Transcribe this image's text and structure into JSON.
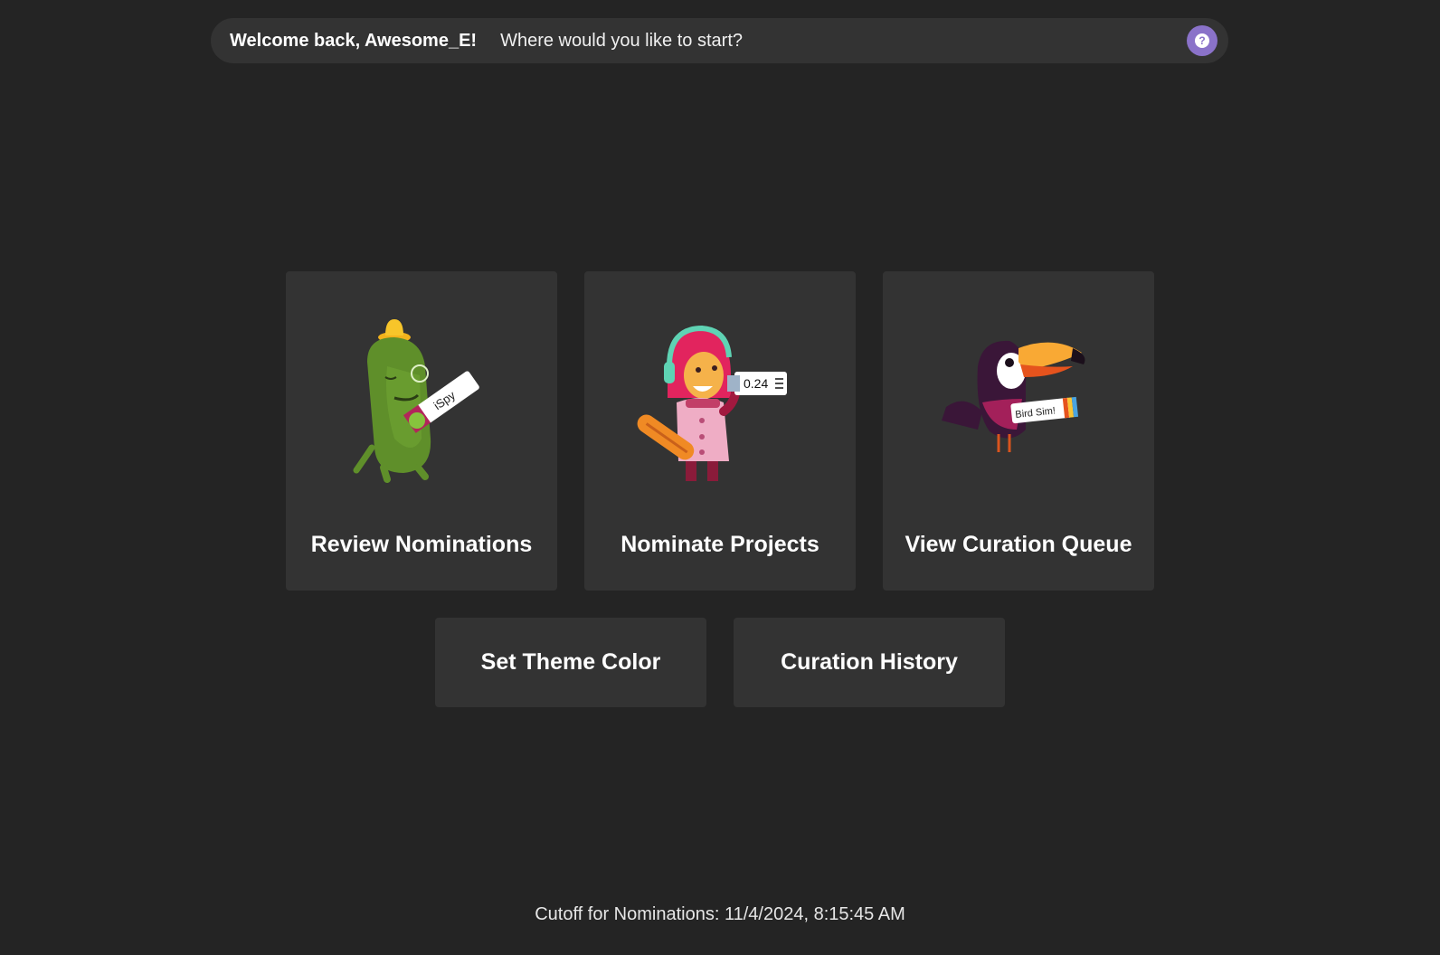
{
  "header": {
    "welcome": "Welcome back, Awesome_E!",
    "prompt": "Where would you like to start?",
    "help_icon": "question-mark-icon",
    "help_symbol": "?"
  },
  "cards": [
    {
      "label": "Review Nominations",
      "illustration": "green-monster-spy-illustration",
      "badge_text": "iSpy"
    },
    {
      "label": "Nominate Projects",
      "illustration": "girl-with-headphones-illustration",
      "badge_text": "0.24"
    },
    {
      "label": "View Curation Queue",
      "illustration": "toucan-illustration",
      "badge_text": "Bird Sim!"
    }
  ],
  "actions": {
    "theme_color": "Set Theme Color",
    "history": "Curation History"
  },
  "footer": {
    "cutoff": "Cutoff for Nominations: 11/4/2024, 8:15:45 AM"
  },
  "colors": {
    "background": "#242424",
    "surface": "#333333",
    "help_accent": "#8a72c9"
  }
}
